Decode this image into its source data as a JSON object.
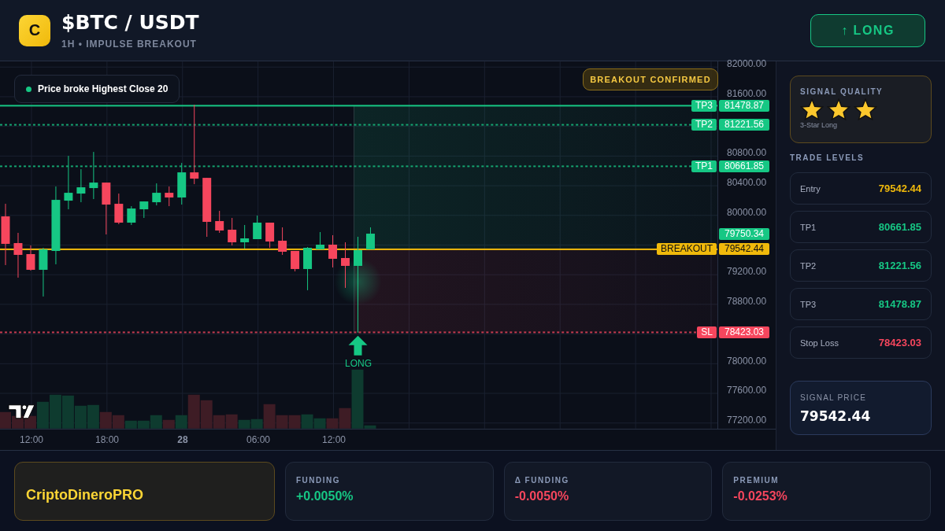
{
  "header": {
    "logo_letter": "C",
    "title": "$BTC / USDT",
    "subtitle": "1H • IMPULSE BREAKOUT",
    "action_button": "↑ LONG"
  },
  "chart": {
    "note": "Price broke Highest Close 20",
    "banner": "BREAKOUT CONFIRMED",
    "y_axis": [
      "82000.00",
      "81600.00",
      "80800.00",
      "80400.00",
      "80000.00",
      "79200.00",
      "78800.00",
      "78000.00",
      "77600.00",
      "77200.00"
    ],
    "x_axis": [
      {
        "label": "12:00",
        "bold": false
      },
      {
        "label": "18:00",
        "bold": false
      },
      {
        "label": "28",
        "bold": true
      },
      {
        "label": "06:00",
        "bold": false
      },
      {
        "label": "12:00",
        "bold": false
      }
    ],
    "price_tags": [
      {
        "kind": "target",
        "label": "TP3",
        "value": "81478.87",
        "dashed": false
      },
      {
        "kind": "target",
        "label": "TP2",
        "value": "81221.56",
        "dashed": true
      },
      {
        "kind": "target",
        "label": "TP1",
        "value": "80661.85",
        "dashed": true
      },
      {
        "kind": "current",
        "value": "79750.34"
      },
      {
        "kind": "breakout",
        "label": "BREAKOUT",
        "value": "79542.44",
        "dashed": false
      },
      {
        "kind": "stop",
        "label": "SL",
        "value": "78423.03",
        "dashed": true
      }
    ],
    "signal_marker": "LONG"
  },
  "side_panel": {
    "quality": {
      "title": "SIGNAL QUALITY",
      "stars": 3,
      "caption": "3-Star Long"
    },
    "levels_title": "TRADE LEVELS",
    "levels": [
      {
        "kind": "entry",
        "label": "Entry",
        "value": "79542.44"
      },
      {
        "kind": "target",
        "label": "TP1",
        "value": "80661.85"
      },
      {
        "kind": "target",
        "label": "TP2",
        "value": "81221.56"
      },
      {
        "kind": "target",
        "label": "TP3",
        "value": "81478.87"
      },
      {
        "kind": "stop",
        "label": "Stop Loss",
        "value": "78423.03"
      }
    ],
    "signal_price": {
      "label": "SIGNAL PRICE",
      "value": "79542.44"
    }
  },
  "stats": [
    {
      "kind": "brand",
      "value": "CriptoDineroPRO"
    },
    {
      "kind": "gain",
      "label": "FUNDING",
      "value": "+0.0050%"
    },
    {
      "kind": "loss",
      "label": "Δ FUNDING",
      "value": "-0.0050%"
    },
    {
      "kind": "loss",
      "label": "PREMIUM",
      "value": "-0.0253%"
    }
  ]
}
